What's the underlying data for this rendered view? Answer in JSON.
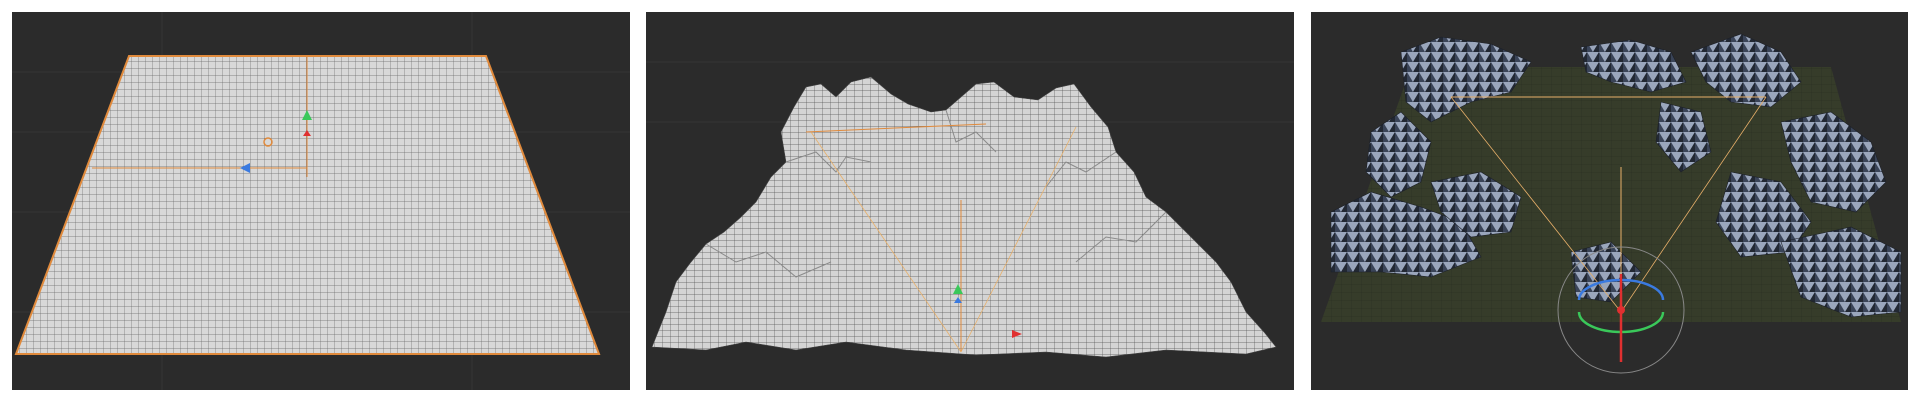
{
  "viewports": [
    {
      "id": "flat-plane",
      "object": "plane-mesh"
    },
    {
      "id": "displaced-terrain",
      "object": "terrain-mesh"
    },
    {
      "id": "shaded-terrain",
      "object": "terrain-mesh-shaded"
    }
  ],
  "colors": {
    "viewport_background": "#2b2b2b",
    "grid_floor_line": "#383838",
    "mesh_face": "#d6d6d6",
    "mesh_wire": "#5a5a5a",
    "selection_outline": "#e08a3c",
    "gizmo_x": "#e03030",
    "gizmo_y": "#3ac85a",
    "gizmo_z": "#3a7ae0",
    "light_line": "#e8b06a",
    "shaded_face_dark": "#2c3340",
    "shaded_face_light": "#c8d2e4",
    "shaded_floor": "#3a4030"
  }
}
